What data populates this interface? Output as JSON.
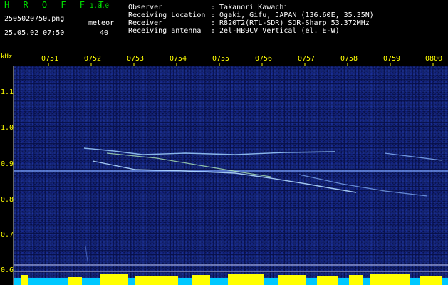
{
  "app": {
    "title": "H R O F F T",
    "version": "1.0.0"
  },
  "capture": {
    "filename": "2505020750.png",
    "datetime": "25.05.02 07:50"
  },
  "counter": {
    "label": "meteor",
    "value": "40"
  },
  "info": [
    {
      "key": "Observer",
      "value": ": Takanori Kawachi"
    },
    {
      "key": "Receiving Location",
      "value": ": Ogaki, Gifu, JAPAN (136.60E, 35.35N)"
    },
    {
      "key": "Receiver",
      "value": ": R820T2(RTL-SDR) SDR-Sharp 53.372MHz"
    },
    {
      "key": "Receiving antenna",
      "value": ": 2el-HB9CV Vertical (el. E-W)"
    }
  ],
  "axis": {
    "unit": "kHz",
    "x_ticks": [
      "0751",
      "0752",
      "0753",
      "0754",
      "0755",
      "0756",
      "0757",
      "0758",
      "0759",
      "0800"
    ],
    "y_ticks": [
      "1.1",
      "1.0",
      "0.9",
      "0.8",
      "0.7",
      "0.6"
    ]
  },
  "colors": {
    "header_green": "#00e000",
    "label_yellow": "#ffff00",
    "text_white": "#ffffff",
    "background": "#08104a"
  }
}
